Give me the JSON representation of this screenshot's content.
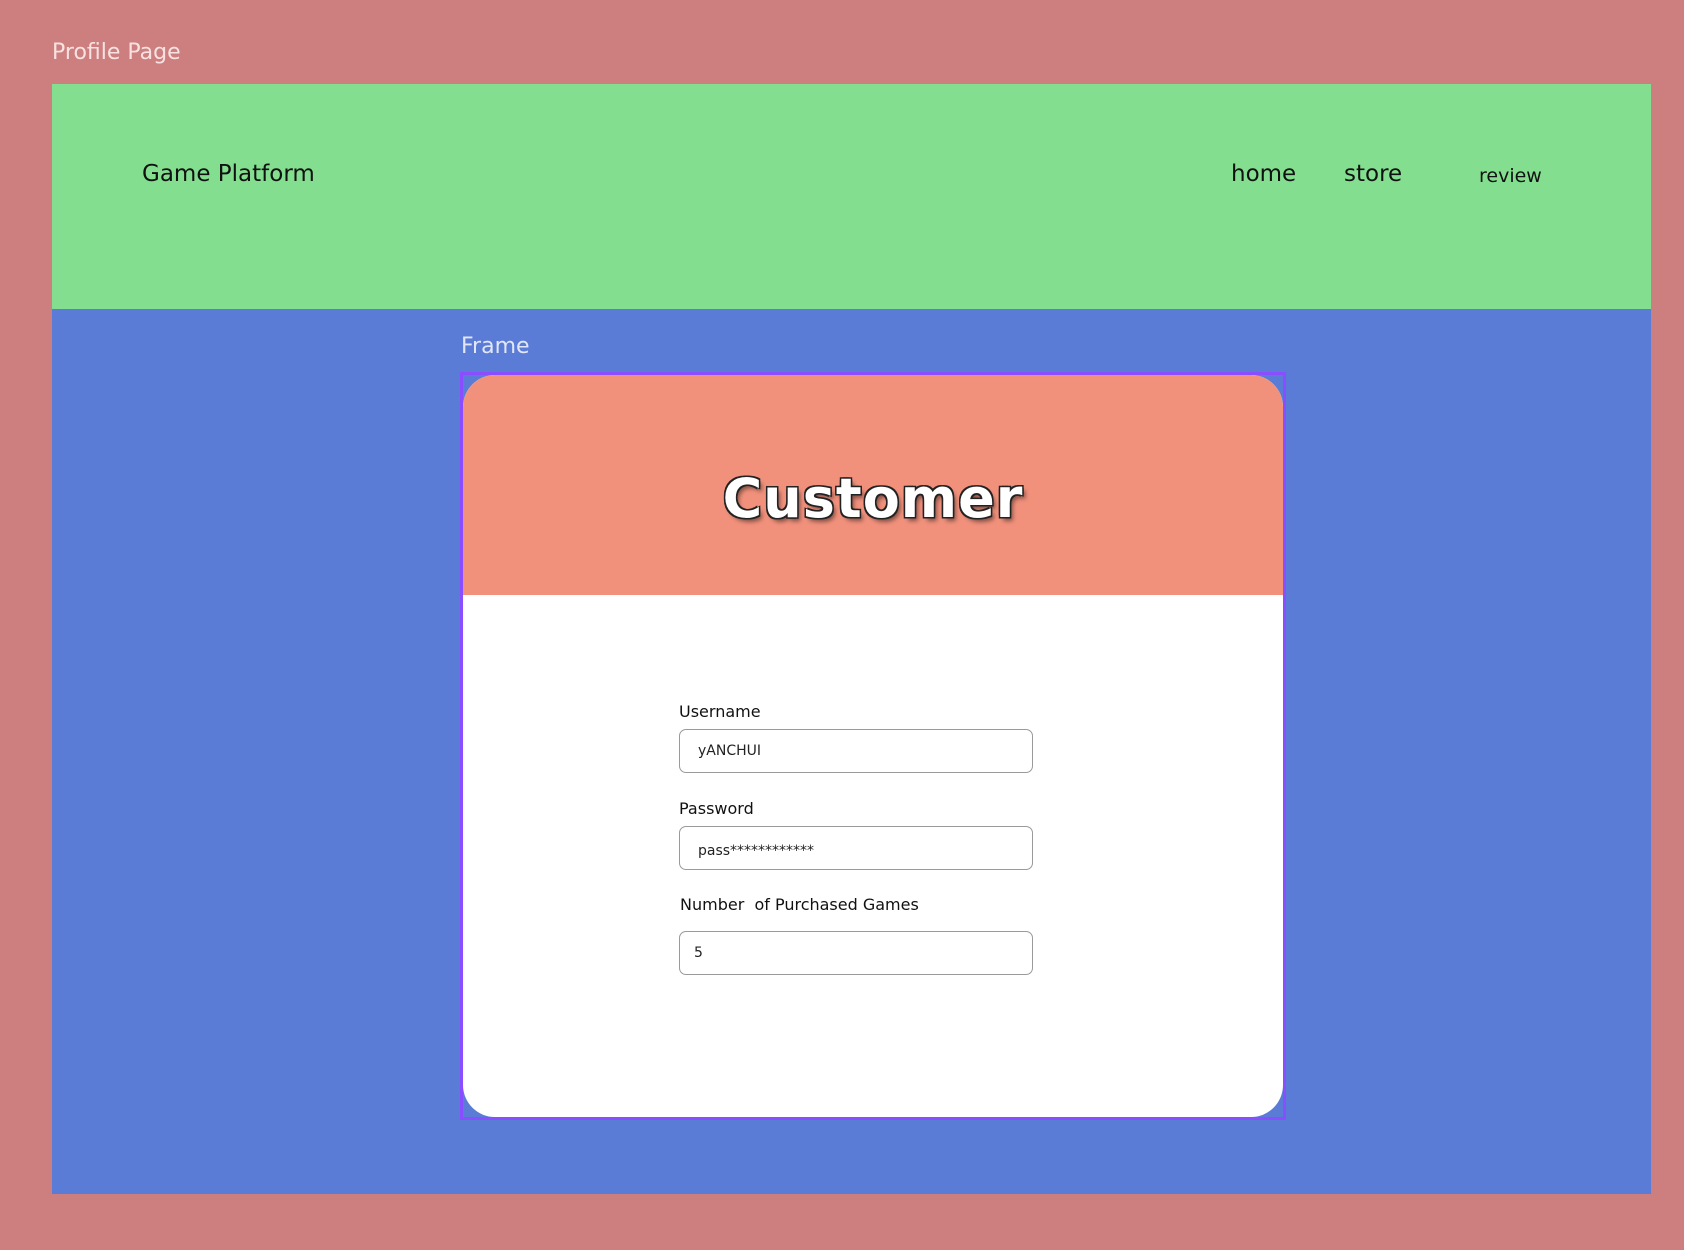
{
  "page": {
    "label": "Profile Page"
  },
  "nav": {
    "brand": "Game Platform",
    "links": [
      {
        "label": "home"
      },
      {
        "label": "store"
      },
      {
        "label": "review"
      }
    ]
  },
  "frame": {
    "label": "Frame"
  },
  "card": {
    "title": "Customer",
    "fields": {
      "username": {
        "label": "Username",
        "value": "yANCHUI"
      },
      "password": {
        "label": "Password",
        "value": "pass************"
      },
      "purchased_games": {
        "label": "Number  of Purchased Games",
        "value": "5"
      }
    }
  },
  "colors": {
    "outer_background": "#cd7f7f",
    "nav_background": "#83df8f",
    "canvas_background": "#5b7cd6",
    "card_header_background": "#f1917c",
    "frame_border": "#8a4dff"
  }
}
